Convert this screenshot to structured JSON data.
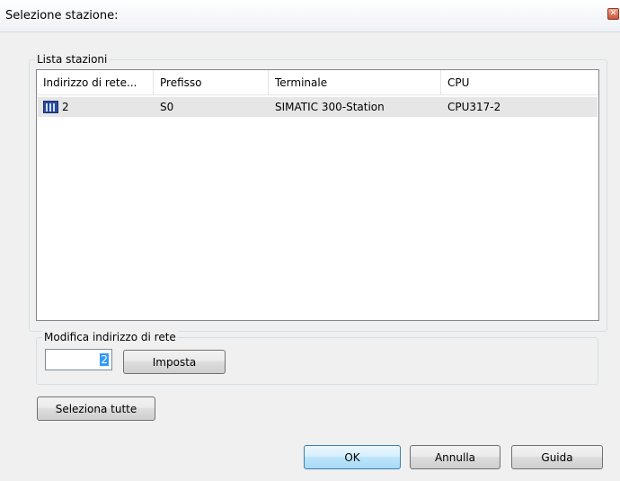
{
  "window": {
    "title": "Selezione stazione:",
    "close_glyph": "✕"
  },
  "stations_group": {
    "title": "Lista stazioni",
    "columns": [
      "Indirizzo di rete...",
      "Prefisso",
      "Terminale",
      "CPU"
    ],
    "rows": [
      {
        "icon": "station-icon",
        "address": "2",
        "prefix": "S0",
        "terminal": "SIMATIC 300-Station",
        "cpu": "CPU317-2"
      }
    ]
  },
  "address_group": {
    "title": "Modifica indirizzo di rete",
    "value": "2",
    "set_label": "Imposta"
  },
  "select_all_label": "Seleziona tutte",
  "buttons": {
    "ok": "OK",
    "cancel": "Annulla",
    "help": "Guida"
  },
  "colors": {
    "selection": "#3399ff",
    "row_highlight": "#e6e6e6",
    "default_button": "#bee6fd"
  }
}
